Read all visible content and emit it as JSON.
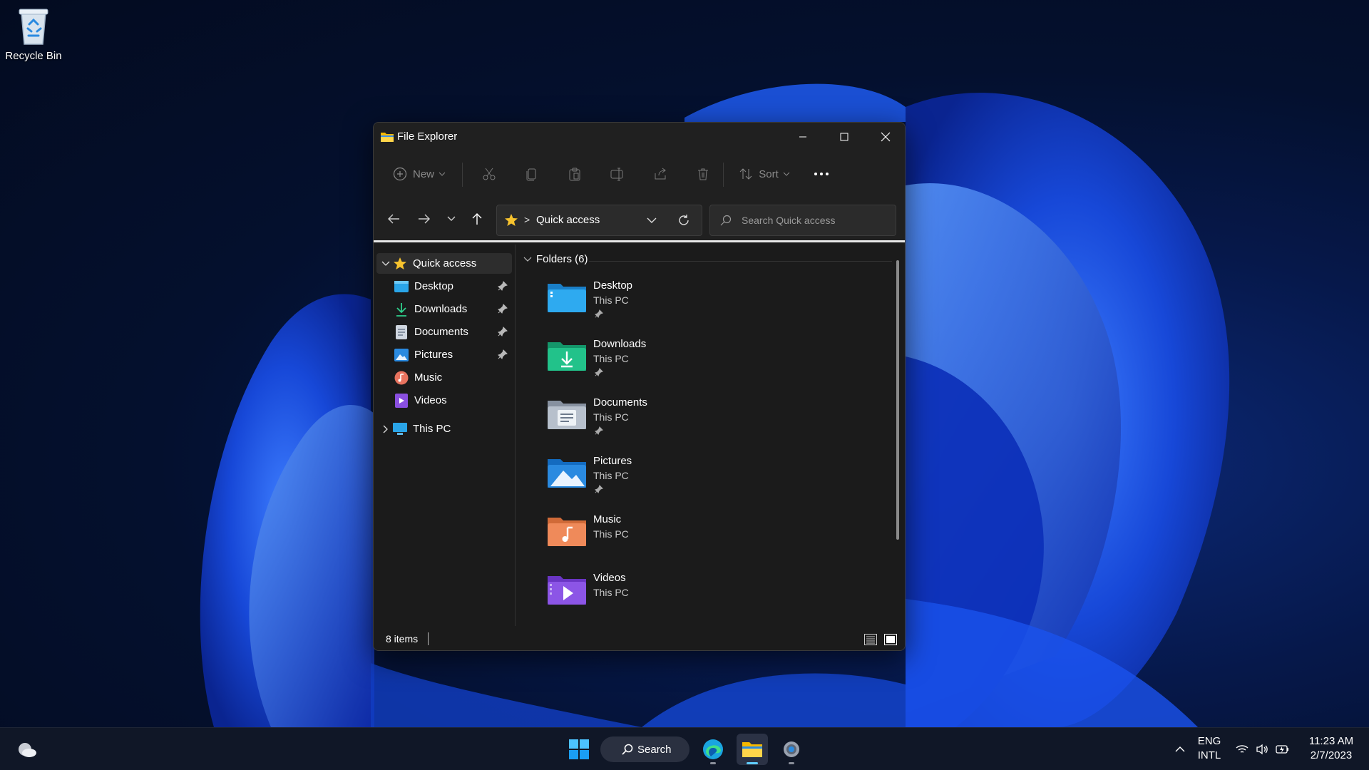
{
  "desktop": {
    "recycle_bin_label": "Recycle Bin"
  },
  "window": {
    "title": "File Explorer",
    "icon": "folder-icon",
    "controls": [
      "minimize-icon",
      "maximize-icon",
      "close-icon"
    ]
  },
  "toolbar": {
    "new_label": "New",
    "sort_label": "Sort",
    "icons": [
      "cut-icon",
      "copy-icon",
      "paste-icon",
      "rename-icon",
      "share-icon",
      "delete-icon",
      "more-icon"
    ]
  },
  "navigation": {
    "address_crumb": "Quick access",
    "address_separator": ">",
    "search_placeholder": "Search Quick access"
  },
  "sidebar": {
    "quick_access_label": "Quick access",
    "items": [
      {
        "label": "Desktop",
        "icon": "desktop-folder-icon",
        "pinned": true
      },
      {
        "label": "Downloads",
        "icon": "downloads-icon",
        "pinned": true
      },
      {
        "label": "Documents",
        "icon": "documents-icon",
        "pinned": true
      },
      {
        "label": "Pictures",
        "icon": "pictures-icon",
        "pinned": true
      },
      {
        "label": "Music",
        "icon": "music-icon",
        "pinned": false
      },
      {
        "label": "Videos",
        "icon": "videos-icon",
        "pinned": false
      }
    ],
    "this_pc_label": "This PC"
  },
  "content": {
    "group_label": "Folders (6)",
    "folders": [
      {
        "name": "Desktop",
        "location": "This PC",
        "pinned": true
      },
      {
        "name": "Downloads",
        "location": "This PC",
        "pinned": true
      },
      {
        "name": "Documents",
        "location": "This PC",
        "pinned": true
      },
      {
        "name": "Pictures",
        "location": "This PC",
        "pinned": true
      },
      {
        "name": "Music",
        "location": "This PC",
        "pinned": false
      },
      {
        "name": "Videos",
        "location": "This PC",
        "pinned": false
      }
    ]
  },
  "status": {
    "item_count": "8 items"
  },
  "taskbar": {
    "search_label": "Search",
    "language_line1": "ENG",
    "language_line2": "INTL",
    "time": "11:23 AM",
    "date": "2/7/2023"
  },
  "colors": {
    "accent": "#60cdff",
    "window_bg": "#1b1b1b",
    "chrome_bg": "#202020",
    "star": "#f7c32e"
  }
}
